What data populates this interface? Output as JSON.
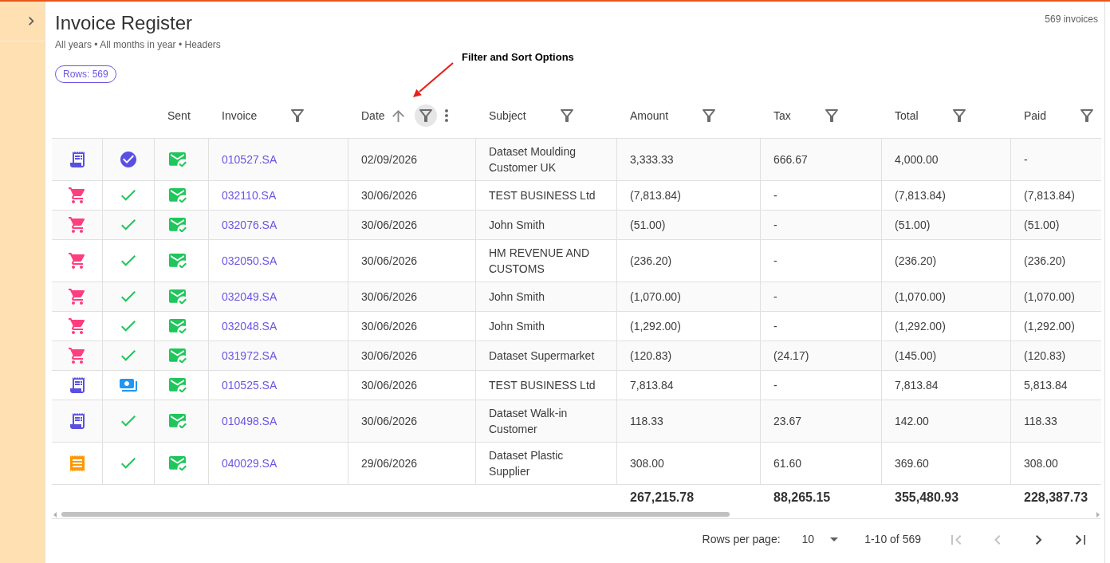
{
  "header": {
    "title": "Invoice Register",
    "subtitle": "All years • All months in year • Headers",
    "count": "569 invoices",
    "rows_chip": "Rows: 569"
  },
  "annotation": {
    "text": "Filter and Sort Options"
  },
  "table": {
    "columns": [
      {
        "label": "Sent",
        "filter": false,
        "sorted": false,
        "menu": false
      },
      {
        "label": "Invoice",
        "filter": true,
        "filter_active": false,
        "sorted": false,
        "menu": false
      },
      {
        "label": "Date",
        "filter": true,
        "filter_active": true,
        "sorted": true,
        "menu": true
      },
      {
        "label": "Subject",
        "filter": true,
        "filter_active": false,
        "sorted": false,
        "menu": false
      },
      {
        "label": "Amount",
        "filter": true,
        "filter_active": false,
        "sorted": false,
        "menu": false
      },
      {
        "label": "Tax",
        "filter": true,
        "filter_active": false,
        "sorted": false,
        "menu": false
      },
      {
        "label": "Total",
        "filter": true,
        "filter_active": false,
        "sorted": false,
        "menu": false
      },
      {
        "label": "Paid",
        "filter": true,
        "filter_active": false,
        "sorted": false,
        "menu": false
      }
    ],
    "rows": [
      {
        "type": {
          "kind": "document"
        },
        "status": {
          "kind": "verified"
        },
        "sent": true,
        "invoice": "010527.SA",
        "date": "02/09/2026",
        "subject": "Dataset Moulding Customer UK",
        "amount": "3,333.33",
        "tax": "666.67",
        "total": "4,000.00",
        "paid": "-"
      },
      {
        "type": {
          "kind": "cart"
        },
        "status": {
          "kind": "complete"
        },
        "sent": true,
        "invoice": "032110.SA",
        "date": "30/06/2026",
        "subject": "TEST BUSINESS Ltd",
        "amount": "(7,813.84)",
        "tax": "-",
        "total": "(7,813.84)",
        "paid": "(7,813.84)"
      },
      {
        "type": {
          "kind": "cart"
        },
        "status": {
          "kind": "complete"
        },
        "sent": true,
        "invoice": "032076.SA",
        "date": "30/06/2026",
        "subject": "John Smith",
        "amount": "(51.00)",
        "tax": "-",
        "total": "(51.00)",
        "paid": "(51.00)"
      },
      {
        "type": {
          "kind": "cart"
        },
        "status": {
          "kind": "complete"
        },
        "sent": true,
        "invoice": "032050.SA",
        "date": "30/06/2026",
        "subject": "HM REVENUE AND CUSTOMS",
        "amount": "(236.20)",
        "tax": "-",
        "total": "(236.20)",
        "paid": "(236.20)"
      },
      {
        "type": {
          "kind": "cart"
        },
        "status": {
          "kind": "complete"
        },
        "sent": true,
        "invoice": "032049.SA",
        "date": "30/06/2026",
        "subject": "John Smith",
        "amount": "(1,070.00)",
        "tax": "-",
        "total": "(1,070.00)",
        "paid": "(1,070.00)"
      },
      {
        "type": {
          "kind": "cart"
        },
        "status": {
          "kind": "complete"
        },
        "sent": true,
        "invoice": "032048.SA",
        "date": "30/06/2026",
        "subject": "John Smith",
        "amount": "(1,292.00)",
        "tax": "-",
        "total": "(1,292.00)",
        "paid": "(1,292.00)"
      },
      {
        "type": {
          "kind": "cart"
        },
        "status": {
          "kind": "complete"
        },
        "sent": true,
        "invoice": "031972.SA",
        "date": "30/06/2026",
        "subject": "Dataset Supermarket",
        "amount": "(120.83)",
        "tax": "(24.17)",
        "total": "(145.00)",
        "paid": "(120.83)"
      },
      {
        "type": {
          "kind": "document"
        },
        "status": {
          "kind": "payment"
        },
        "sent": true,
        "invoice": "010525.SA",
        "date": "30/06/2026",
        "subject": "TEST BUSINESS Ltd",
        "amount": "7,813.84",
        "tax": "-",
        "total": "7,813.84",
        "paid": "5,813.84"
      },
      {
        "type": {
          "kind": "document"
        },
        "status": {
          "kind": "complete"
        },
        "sent": true,
        "invoice": "010498.SA",
        "date": "30/06/2026",
        "subject": "Dataset Walk-in Customer",
        "amount": "118.33",
        "tax": "23.67",
        "total": "142.00",
        "paid": "118.33"
      },
      {
        "type": {
          "kind": "receipt"
        },
        "status": {
          "kind": "complete"
        },
        "sent": true,
        "invoice": "040029.SA",
        "date": "29/06/2026",
        "subject": "Dataset Plastic Supplier",
        "amount": "308.00",
        "tax": "61.60",
        "total": "369.60",
        "paid": "308.00"
      }
    ],
    "totals": {
      "amount": "267,215.78",
      "tax": "88,265.15",
      "total": "355,480.93",
      "paid": "228,387.73"
    }
  },
  "pagination": {
    "rows_per_page_label": "Rows per page:",
    "rows_per_page": "10",
    "range": "1-10 of 569",
    "buttons": [
      {
        "kind": "first",
        "disabled": true
      },
      {
        "kind": "previous",
        "disabled": true
      },
      {
        "kind": "next",
        "disabled": false
      },
      {
        "kind": "last",
        "disabled": false
      }
    ]
  }
}
